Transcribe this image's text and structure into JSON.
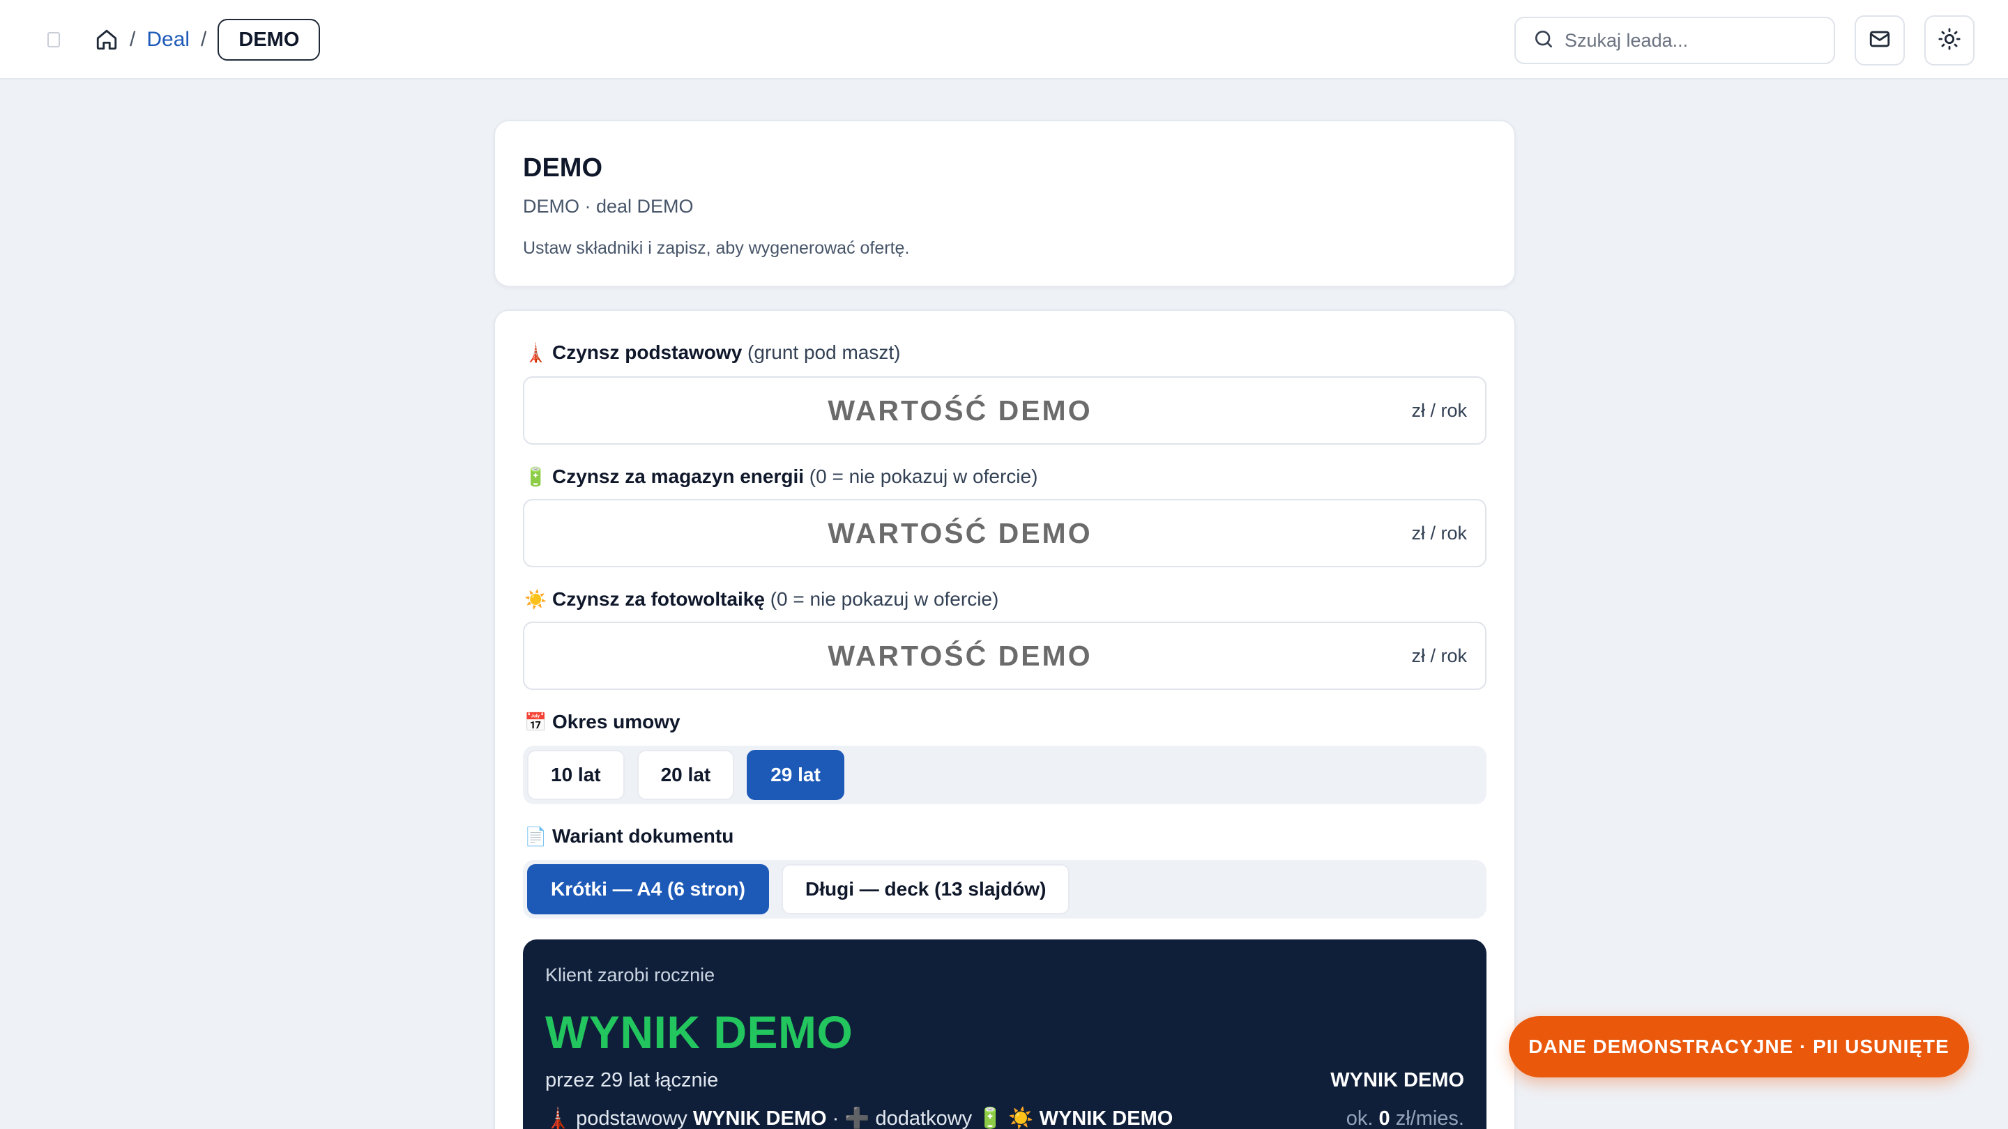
{
  "breadcrumb": {
    "deal_link": "Deal",
    "separator": "/",
    "current": "DEMO"
  },
  "search": {
    "placeholder": "Szukaj leada..."
  },
  "header_card": {
    "title": "DEMO",
    "subtitle": "DEMO · deal DEMO",
    "hint": "Ustaw składniki i zapisz, aby wygenerować ofertę."
  },
  "fields": [
    {
      "icon": "antenna-tower-icon",
      "emoji": "🗼",
      "label": "Czynsz podstawowy",
      "note": "(grunt pod maszt)",
      "value": "WARTOŚĆ DEMO",
      "unit": "zł / rok"
    },
    {
      "icon": "battery-icon",
      "emoji": "🔋",
      "label": "Czynsz za magazyn energii",
      "note": "(0 = nie pokazuj w ofercie)",
      "value": "WARTOŚĆ DEMO",
      "unit": "zł / rok"
    },
    {
      "icon": "sun-icon",
      "emoji": "☀️",
      "label": "Czynsz za fotowoltaikę",
      "note": "(0 = nie pokazuj w ofercie)",
      "value": "WARTOŚĆ DEMO",
      "unit": "zł / rok"
    }
  ],
  "term": {
    "emoji": "📅",
    "label": "Okres umowy",
    "options": [
      "10 lat",
      "20 lat",
      "29 lat"
    ],
    "selected": "29 lat"
  },
  "variant": {
    "emoji": "📄",
    "label": "Wariant dokumentu",
    "options": [
      "Krótki — A4 (6 stron)",
      "Długi — deck (13 slajdów)"
    ],
    "selected": "Krótki — A4 (6 stron)"
  },
  "summary": {
    "label": "Klient zarobi rocznie",
    "big_value": "WYNIK DEMO",
    "period": "przez 29 lat łącznie",
    "total": "WYNIK DEMO",
    "base_emoji": "🗼",
    "base_text": "podstawowy",
    "base_value": "WYNIK DEMO",
    "dot": "·",
    "plus": "➕",
    "extra_text": "dodatkowy",
    "extra_emojis": "🔋 ☀️",
    "extra_value": "WYNIK DEMO",
    "monthly_prefix": "ok.",
    "monthly_value": "0",
    "monthly_unit": "zł/mies."
  },
  "demo_banner": "DANE DEMONSTRACYJNE · PII USUNIĘTE",
  "colors": {
    "accent": "#1d5ab8",
    "summary_bg": "#0f1f3a",
    "summary_value": "#22c55e",
    "banner": "#ea580c"
  }
}
